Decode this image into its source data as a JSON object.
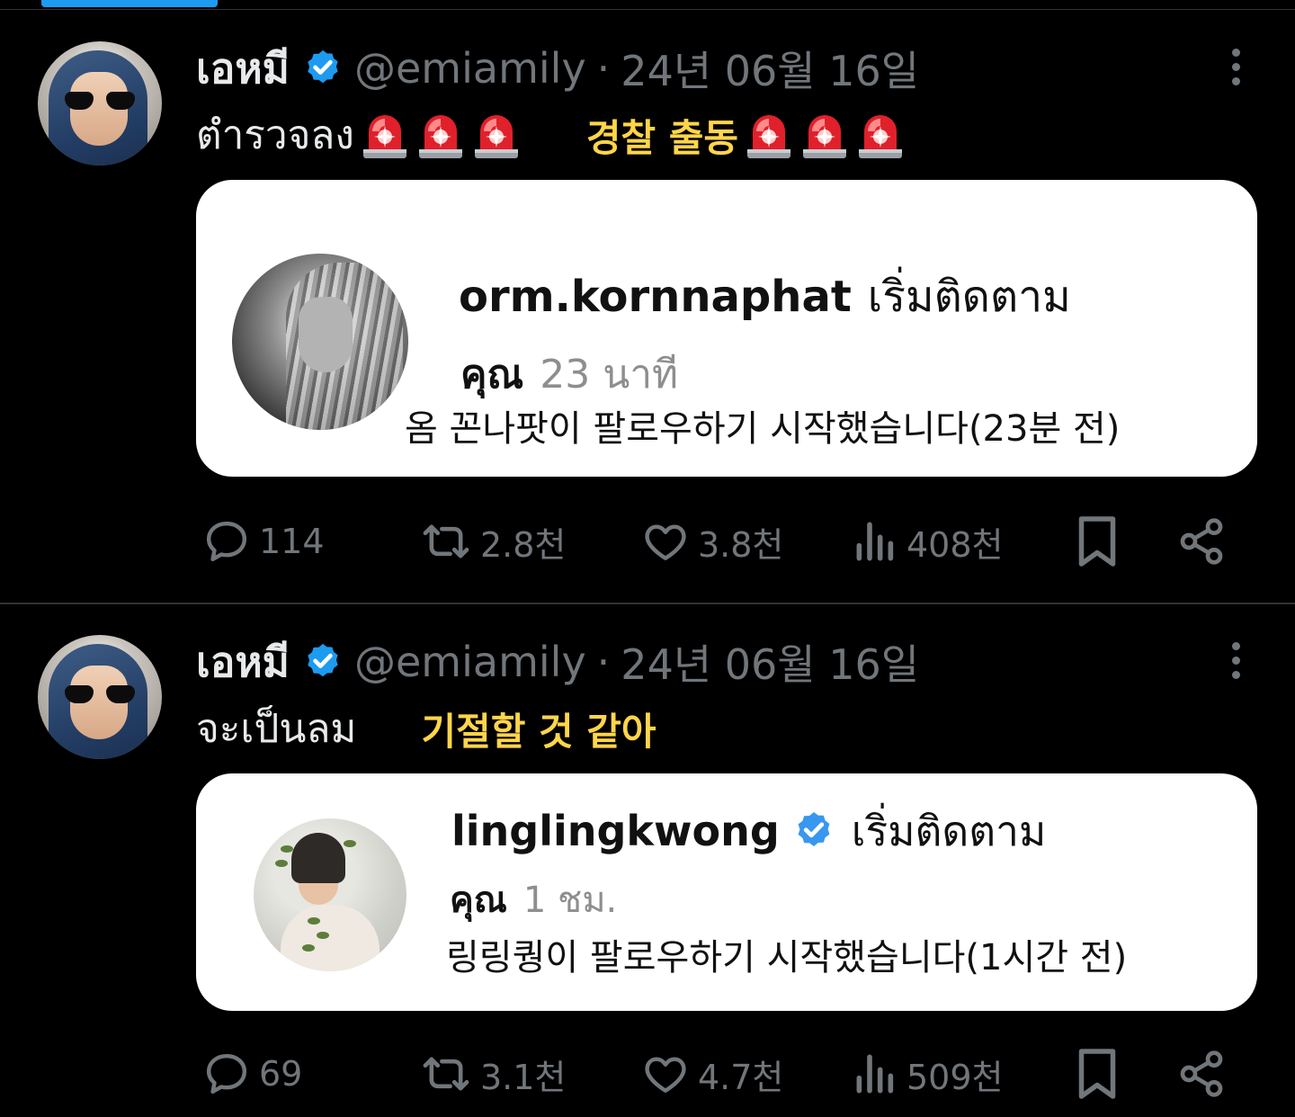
{
  "tweets": [
    {
      "author": {
        "name": "เอหมี",
        "handle": "@emiamily"
      },
      "date": "24년 06월 16일",
      "text_thai": "ตำรวจลง",
      "text_korean": "경찰 출동",
      "siren_count": 3,
      "embedded": {
        "username": "orm.kornnaphat",
        "verified": false,
        "action": "เริ่มติดตาม",
        "subject": "คุณ",
        "time": "23 นาที",
        "korean_caption": "옴 꼰나팟이 팔로우하기 시작했습니다(23분 전)"
      },
      "stats": {
        "replies": "114",
        "retweets": "2.8천",
        "likes": "3.8천",
        "views": "408천"
      }
    },
    {
      "author": {
        "name": "เอหมี",
        "handle": "@emiamily"
      },
      "date": "24년 06월 16일",
      "text_thai": "จะเป็นลม",
      "text_korean": "기절할 것 같아",
      "siren_count": 0,
      "embedded": {
        "username": "linglingkwong",
        "verified": true,
        "action": "เริ่มติดตาม",
        "subject": "คุณ",
        "time": "1 ชม.",
        "korean_caption": "링링퀑이 팔로우하기 시작했습니다(1시간 전)"
      },
      "stats": {
        "replies": "69",
        "retweets": "3.1천",
        "likes": "4.7천",
        "views": "509천"
      }
    }
  ],
  "colors": {
    "background": "#000000",
    "text": "#e7e9ea",
    "muted": "#71767b",
    "verified": "#1d9bf0",
    "korean_overlay": "#ffd54a",
    "card": "#ffffff"
  },
  "icons": [
    "verified-badge-icon",
    "more-icon",
    "reply-icon",
    "retweet-icon",
    "like-icon",
    "views-icon",
    "bookmark-icon",
    "share-icon",
    "siren-emoji-icon"
  ]
}
